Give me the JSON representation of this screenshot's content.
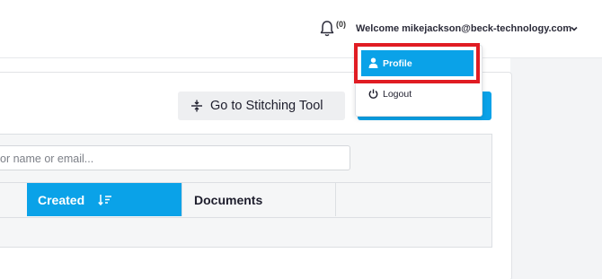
{
  "header": {
    "notification_count": "(0)",
    "welcome_text": "Welcome mikejackson@beck-technology.com"
  },
  "user_menu": {
    "items": [
      {
        "label": "Profile",
        "icon": "user-icon",
        "state": "highlighted"
      },
      {
        "label": "Logout",
        "icon": "power-icon"
      }
    ]
  },
  "toolbar": {
    "stitching_label": "Go to Stitching Tool",
    "stitching_icon": "split-icon"
  },
  "search": {
    "partial_placeholder": "or name or email..."
  },
  "table": {
    "columns": [
      {
        "label": "Created",
        "sorted": "descending"
      },
      {
        "label": "Documents"
      }
    ]
  },
  "colors": {
    "accent": "#0aa2e8",
    "highlight_border": "#e01c23"
  }
}
